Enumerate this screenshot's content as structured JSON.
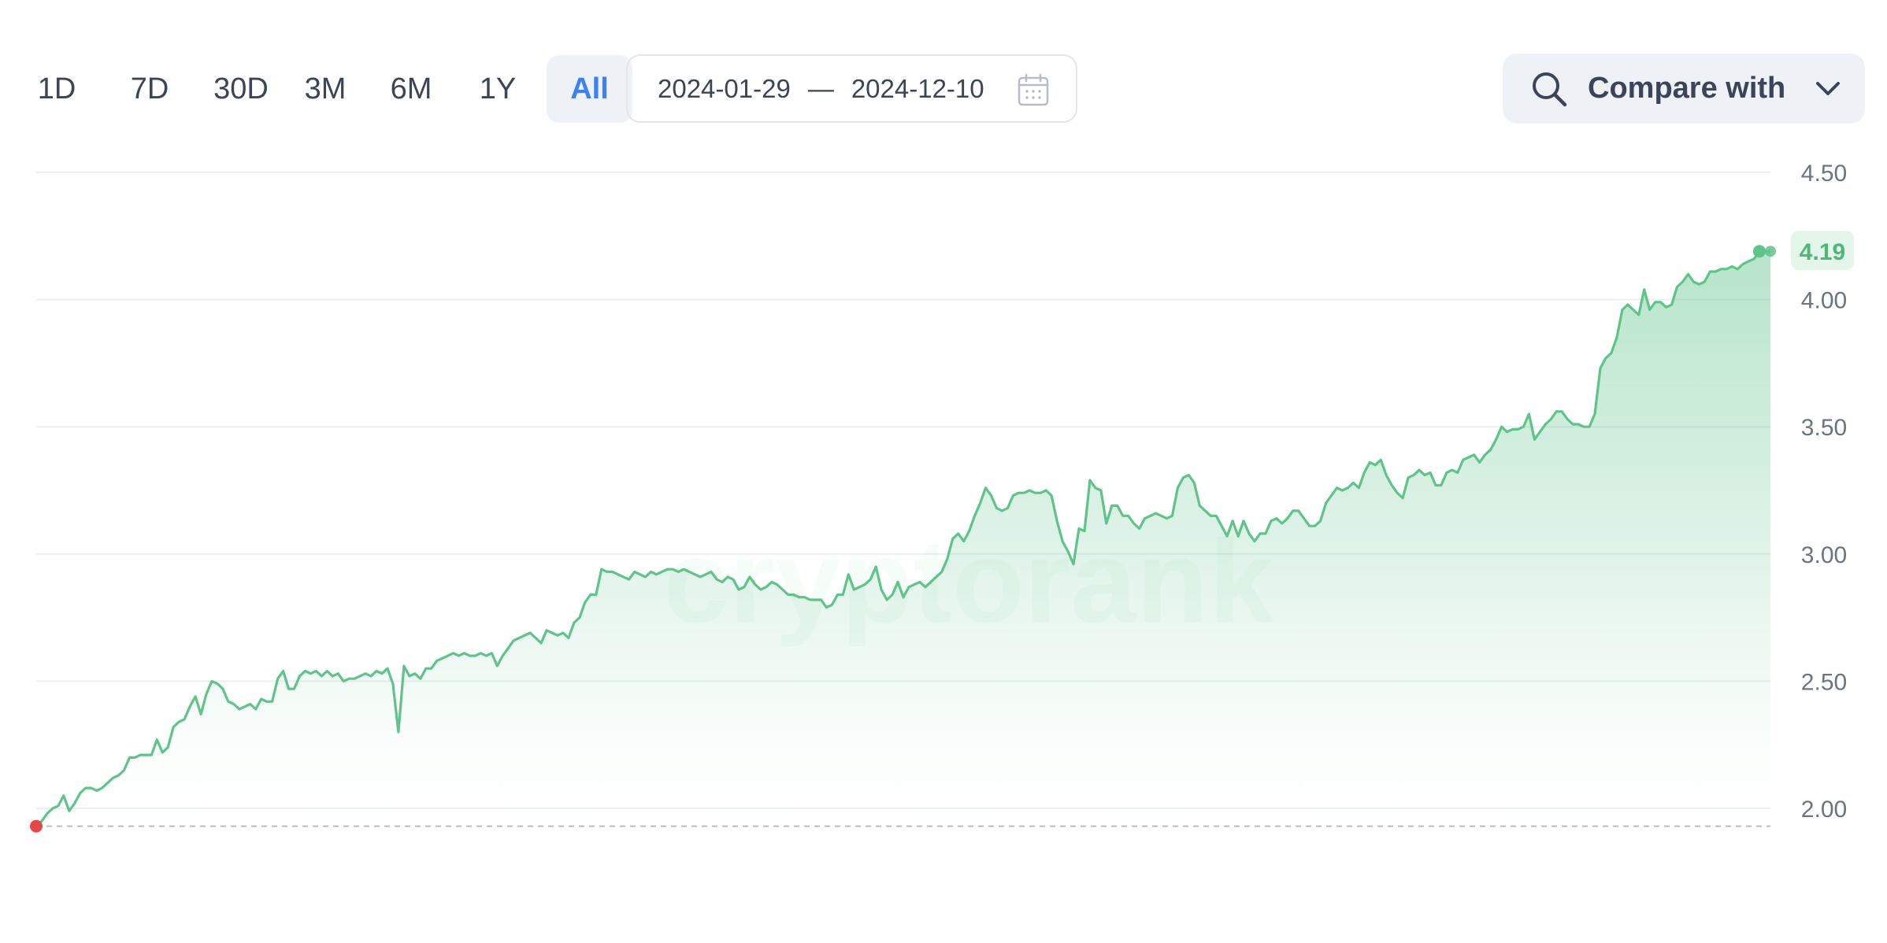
{
  "range_tabs": [
    {
      "label": "1D",
      "active": false
    },
    {
      "label": "7D",
      "active": false
    },
    {
      "label": "30D",
      "active": false
    },
    {
      "label": "3M",
      "active": false
    },
    {
      "label": "6M",
      "active": false
    },
    {
      "label": "1Y",
      "active": false
    },
    {
      "label": "All",
      "active": true
    }
  ],
  "date_range": {
    "start": "2024-01-29",
    "separator": "—",
    "end": "2024-12-10"
  },
  "compare": {
    "label": "Compare with",
    "icon": "search-icon",
    "dropdown_icon": "chevron-down-icon"
  },
  "watermark": "cryptorank",
  "colors": {
    "line": "#5ec48a",
    "area": "#5ec48a",
    "start_marker": "#e84545",
    "accent": "#3b82f6",
    "price_badge_bg": "#e4f5ea",
    "price_badge_text": "#4cb87a"
  },
  "chart_data": {
    "type": "area",
    "x_start": "2024-01-29",
    "x_end": "2024-12-10",
    "ylim": [
      1.93,
      4.5
    ],
    "y_ticks": [
      "4.50",
      "4.00",
      "3.50",
      "3.00",
      "2.50",
      "2.00"
    ],
    "y_tick_values": [
      4.5,
      4.0,
      3.5,
      3.0,
      2.5,
      2.0
    ],
    "grid": true,
    "baseline_value": 1.93,
    "last_value_label": "4.19",
    "last_value": 4.19,
    "series": [
      {
        "values": [
          1.93,
          1.95,
          1.98,
          2.0,
          2.01,
          2.05,
          1.99,
          2.02,
          2.06,
          2.08,
          2.08,
          2.07,
          2.08,
          2.1,
          2.12,
          2.13,
          2.15,
          2.2,
          2.2,
          2.21,
          2.21,
          2.21,
          2.27,
          2.22,
          2.24,
          2.32,
          2.34,
          2.35,
          2.4,
          2.44,
          2.37,
          2.45,
          2.5,
          2.49,
          2.47,
          2.42,
          2.41,
          2.39,
          2.4,
          2.41,
          2.39,
          2.43,
          2.42,
          2.42,
          2.51,
          2.54,
          2.47,
          2.47,
          2.52,
          2.54,
          2.53,
          2.54,
          2.52,
          2.54,
          2.52,
          2.53,
          2.5,
          2.51,
          2.51,
          2.52,
          2.53,
          2.52,
          2.54,
          2.53,
          2.55,
          2.49,
          2.3,
          2.56,
          2.52,
          2.53,
          2.51,
          2.55,
          2.55,
          2.58,
          2.59,
          2.6,
          2.61,
          2.6,
          2.61,
          2.6,
          2.6,
          2.61,
          2.6,
          2.61,
          2.56,
          2.6,
          2.63,
          2.66,
          2.67,
          2.68,
          2.69,
          2.67,
          2.65,
          2.7,
          2.69,
          2.68,
          2.69,
          2.67,
          2.73,
          2.75,
          2.81,
          2.84,
          2.84,
          2.94,
          2.93,
          2.93,
          2.92,
          2.91,
          2.9,
          2.93,
          2.92,
          2.91,
          2.93,
          2.92,
          2.93,
          2.94,
          2.94,
          2.93,
          2.94,
          2.93,
          2.92,
          2.91,
          2.92,
          2.93,
          2.9,
          2.89,
          2.91,
          2.9,
          2.86,
          2.87,
          2.91,
          2.88,
          2.86,
          2.87,
          2.89,
          2.88,
          2.86,
          2.84,
          2.84,
          2.83,
          2.83,
          2.82,
          2.82,
          2.82,
          2.79,
          2.8,
          2.84,
          2.84,
          2.92,
          2.86,
          2.87,
          2.88,
          2.9,
          2.95,
          2.86,
          2.82,
          2.84,
          2.89,
          2.83,
          2.87,
          2.88,
          2.89,
          2.87,
          2.89,
          2.91,
          2.93,
          2.98,
          3.06,
          3.08,
          3.05,
          3.09,
          3.15,
          3.2,
          3.26,
          3.23,
          3.18,
          3.17,
          3.18,
          3.23,
          3.24,
          3.24,
          3.25,
          3.24,
          3.24,
          3.25,
          3.23,
          3.13,
          3.05,
          3.01,
          2.96,
          3.1,
          3.09,
          3.29,
          3.26,
          3.25,
          3.12,
          3.19,
          3.19,
          3.15,
          3.15,
          3.12,
          3.1,
          3.14,
          3.15,
          3.16,
          3.15,
          3.14,
          3.15,
          3.26,
          3.3,
          3.31,
          3.28,
          3.19,
          3.17,
          3.15,
          3.15,
          3.11,
          3.07,
          3.13,
          3.07,
          3.13,
          3.08,
          3.05,
          3.08,
          3.08,
          3.13,
          3.14,
          3.12,
          3.14,
          3.17,
          3.17,
          3.14,
          3.11,
          3.11,
          3.13,
          3.2,
          3.23,
          3.26,
          3.25,
          3.26,
          3.28,
          3.26,
          3.32,
          3.36,
          3.35,
          3.37,
          3.31,
          3.27,
          3.24,
          3.22,
          3.3,
          3.31,
          3.33,
          3.31,
          3.32,
          3.27,
          3.27,
          3.32,
          3.33,
          3.32,
          3.37,
          3.38,
          3.39,
          3.36,
          3.39,
          3.41,
          3.45,
          3.5,
          3.48,
          3.49,
          3.49,
          3.5,
          3.55,
          3.45,
          3.48,
          3.51,
          3.53,
          3.56,
          3.56,
          3.53,
          3.51,
          3.51,
          3.5,
          3.5,
          3.55,
          3.73,
          3.77,
          3.79,
          3.85,
          3.96,
          3.98,
          3.96,
          3.94,
          4.04,
          3.96,
          3.99,
          3.99,
          3.97,
          3.98,
          4.05,
          4.07,
          4.1,
          4.07,
          4.06,
          4.07,
          4.11,
          4.11,
          4.12,
          4.12,
          4.13,
          4.12,
          4.14,
          4.15,
          4.16,
          4.19,
          4.19,
          4.19
        ]
      }
    ]
  }
}
